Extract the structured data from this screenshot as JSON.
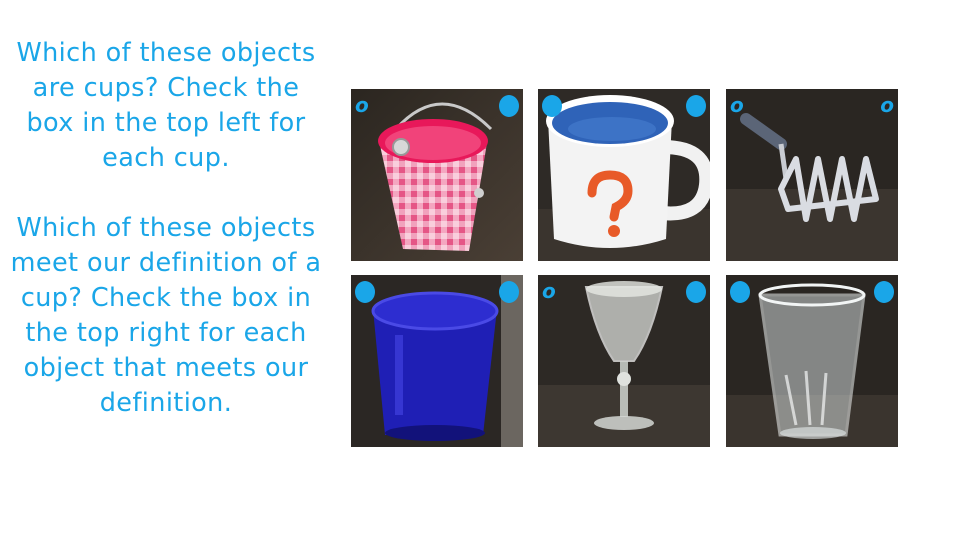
{
  "instructions": {
    "question1": "Which of these objects are cups? Check the box in the top left for each cup.",
    "question2": "Which of these objects meet our definition of a cup? Check the box in the top right for each object that meets our definition."
  },
  "accent_color": "#1aa6e8",
  "tiles": [
    {
      "object": "pink-gingham-pail",
      "top_left": {
        "state": "open",
        "symbol": "o"
      },
      "top_right": {
        "state": "filled"
      }
    },
    {
      "object": "question-mark-mug",
      "top_left": {
        "state": "filled"
      },
      "top_right": {
        "state": "filled"
      }
    },
    {
      "object": "potato-masher",
      "top_left": {
        "state": "open",
        "symbol": "o"
      },
      "top_right": {
        "state": "open",
        "symbol": "o"
      }
    },
    {
      "object": "blue-glass-tumbler",
      "top_left": {
        "state": "filled"
      },
      "top_right": {
        "state": "filled"
      }
    },
    {
      "object": "stemmed-glass",
      "top_left": {
        "state": "open",
        "symbol": "o"
      },
      "top_right": {
        "state": "filled"
      }
    },
    {
      "object": "clear-drinking-glass",
      "top_left": {
        "state": "filled"
      },
      "top_right": {
        "state": "filled"
      }
    }
  ]
}
